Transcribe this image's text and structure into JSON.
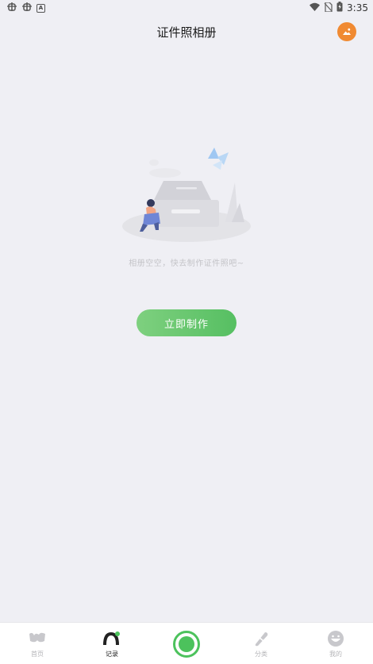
{
  "status_bar": {
    "left_icons": [
      "bug-icon",
      "bug-icon",
      "a-icon"
    ],
    "right_icons": [
      "wifi-icon",
      "no-sim-icon",
      "battery-icon"
    ],
    "time": "3:35"
  },
  "header": {
    "title": "证件照相册",
    "action_icon": "photo-icon",
    "action_color": "#f08a32"
  },
  "empty_state": {
    "illustration": "empty-inbox-illustration",
    "message": "相册空空，快去制作证件照吧~",
    "button_label": "立即制作",
    "button_color": "#5cc365"
  },
  "bottom_nav": {
    "items": [
      {
        "label": "首页",
        "icon": "home-icon",
        "active": false
      },
      {
        "label": "记录",
        "icon": "record-icon",
        "active": true
      },
      {
        "label": "",
        "icon": "camera-shutter-icon",
        "active": false
      },
      {
        "label": "分类",
        "icon": "category-icon",
        "active": false
      },
      {
        "label": "我的",
        "icon": "profile-icon",
        "active": false
      }
    ],
    "accent": "#4cc25c"
  }
}
